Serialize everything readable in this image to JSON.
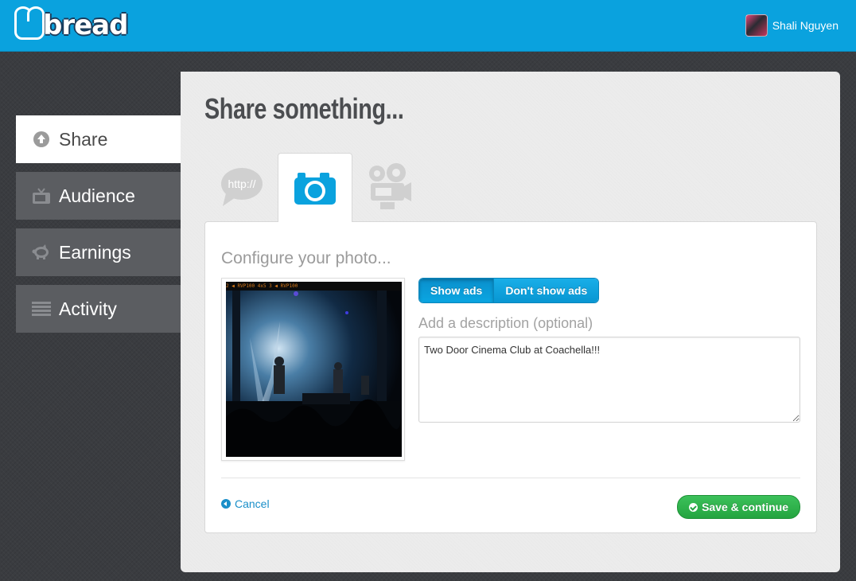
{
  "header": {
    "logo_text": "bread",
    "user_name": "Shali Nguyen"
  },
  "sidebar": {
    "items": [
      {
        "label": "Share",
        "icon": "upload-circle-icon",
        "active": true
      },
      {
        "label": "Audience",
        "icon": "tv-icon",
        "active": false
      },
      {
        "label": "Earnings",
        "icon": "piggy-bank-icon",
        "active": false
      },
      {
        "label": "Activity",
        "icon": "list-icon",
        "active": false
      }
    ]
  },
  "main": {
    "title": "Share something...",
    "tabs": [
      {
        "name": "link",
        "icon": "speech-bubble-link-icon",
        "label": "http://",
        "active": false
      },
      {
        "name": "photo",
        "icon": "camera-icon",
        "active": true
      },
      {
        "name": "video",
        "icon": "video-camera-icon",
        "active": false
      }
    ],
    "card": {
      "title": "Configure your photo...",
      "photo_strip_text": "2 ◀ RVP100        4x5  3 ◀ RVP100",
      "ads_toggle": {
        "show_label": "Show ads",
        "hide_label": "Don't show ads",
        "selected": "show"
      },
      "description_label": "Add a description (optional)",
      "description_value": "Two Door Cinema Club at Coachella!!!",
      "cancel_label": "Cancel",
      "save_label": "Save & continue"
    }
  },
  "colors": {
    "header_blue": "#0aa2de",
    "save_green": "#2bb04a",
    "link_blue": "#1a8fc9",
    "tab_icon_gray": "#d0d0d0"
  }
}
